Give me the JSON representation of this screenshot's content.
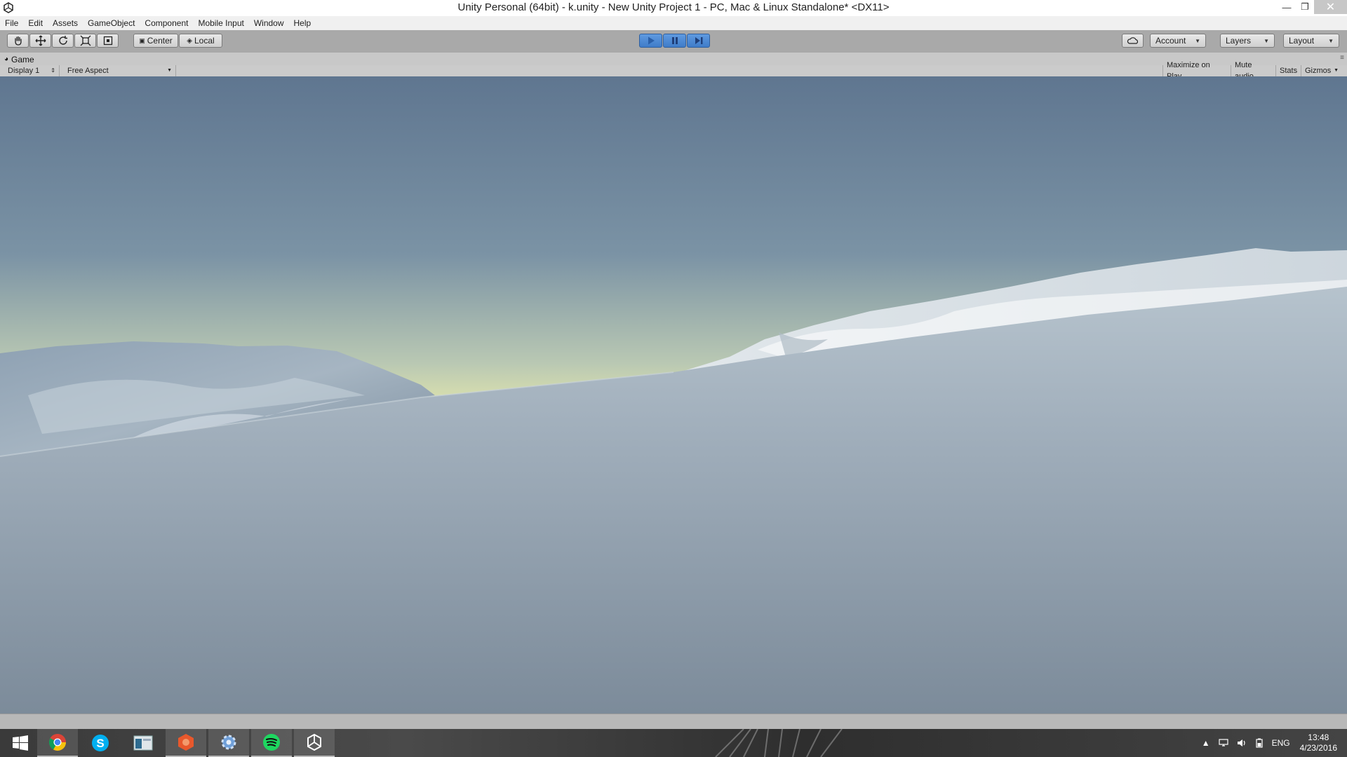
{
  "window": {
    "title": "Unity Personal (64bit) - k.unity - New Unity Project 1 - PC, Mac & Linux Standalone* <DX11>",
    "controls": [
      "minimize",
      "restore",
      "close"
    ]
  },
  "menu": [
    "File",
    "Edit",
    "Assets",
    "GameObject",
    "Component",
    "Mobile Input",
    "Window",
    "Help"
  ],
  "toolbar": {
    "tools": [
      "hand-tool",
      "move-tool",
      "rotate-tool",
      "scale-tool",
      "rect-tool"
    ],
    "pivot_mode": "Center",
    "pivot_rotation": "Local",
    "playback": {
      "play_active": true,
      "pause_active": false,
      "step_active": false
    },
    "account_label": "Account",
    "layers_label": "Layers",
    "layout_label": "Layout"
  },
  "game_view": {
    "tab_label": "Game",
    "display": "Display 1",
    "aspect": "Free Aspect",
    "toggles": [
      "Maximize on Play",
      "Mute audio",
      "Stats",
      "Gizmos"
    ]
  },
  "taskbar": {
    "apps": [
      {
        "name": "start",
        "open": false
      },
      {
        "name": "chrome",
        "open": true
      },
      {
        "name": "skype",
        "open": false
      },
      {
        "name": "explorer",
        "open": false
      },
      {
        "name": "app-orange",
        "open": true
      },
      {
        "name": "settings-gear",
        "open": true
      },
      {
        "name": "spotify",
        "open": true
      },
      {
        "name": "unity",
        "open": true
      }
    ],
    "language": "ENG",
    "time": "13:48",
    "date": "4/23/2016"
  },
  "colors": {
    "sky_top": "#617891",
    "horizon_glow": "#dde4ae",
    "ground_brown": "#5c4530",
    "snow_light": "#e8edf0",
    "snow_shadow": "#7f8fa0",
    "play_blue": "#4a86d4"
  }
}
